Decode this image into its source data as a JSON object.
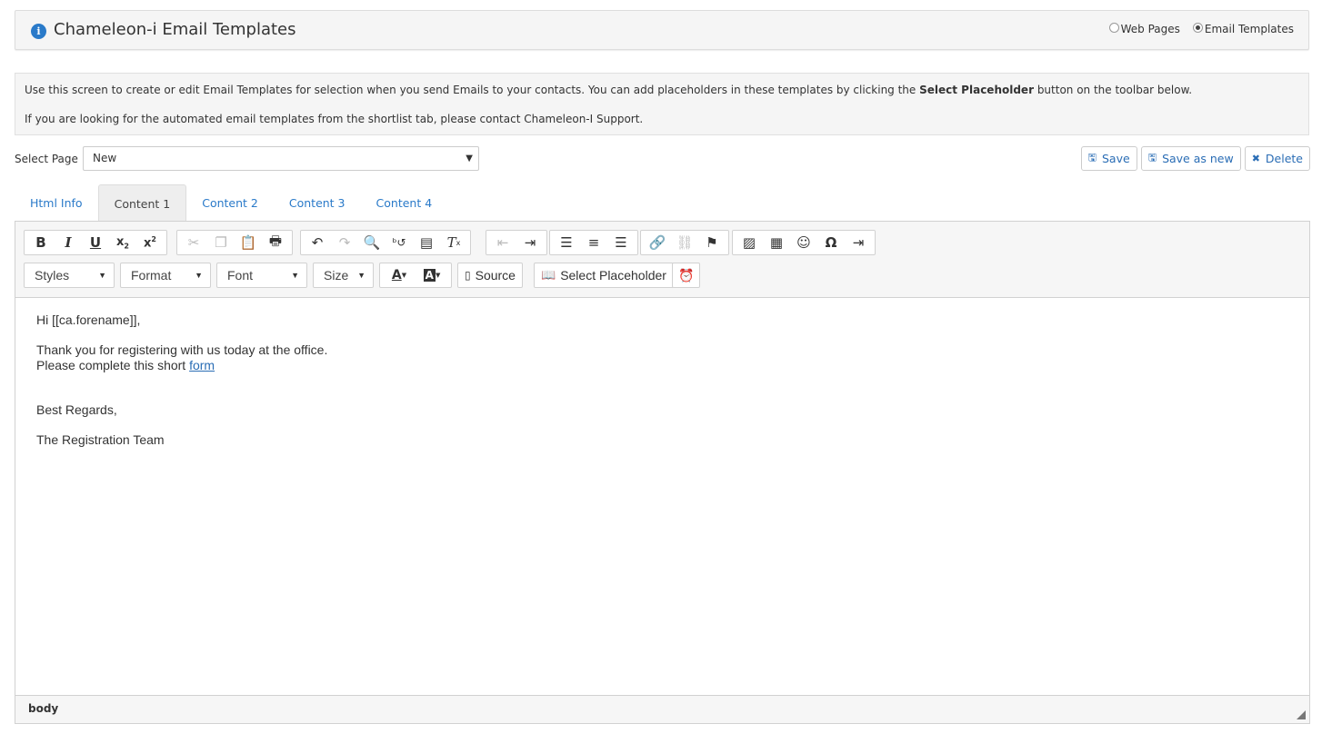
{
  "header": {
    "title": "Chameleon-i Email Templates",
    "info_icon": "info-circle-icon",
    "radio_web_pages": "Web Pages",
    "radio_email_templates": "Email Templates",
    "selected": "Email Templates"
  },
  "notice": {
    "line1_pre": "Use this screen to create or edit Email Templates for selection when you send Emails to your contacts. You can add placeholders in these templates by clicking the ",
    "line1_bold": "Select Placeholder",
    "line1_post": " button on the toolbar below.",
    "line2": "If you are looking for the automated email templates from the shortlist tab, please contact Chameleon-I Support."
  },
  "page_select": {
    "label": "Select Page",
    "value": "New"
  },
  "actions": {
    "save": "Save",
    "save_as_new": "Save as new",
    "delete": "Delete"
  },
  "tabs": [
    {
      "label": "Html Info",
      "active": false
    },
    {
      "label": "Content 1",
      "active": true
    },
    {
      "label": "Content 2",
      "active": false
    },
    {
      "label": "Content 3",
      "active": false
    },
    {
      "label": "Content 4",
      "active": false
    }
  ],
  "toolbar": {
    "styles": "Styles",
    "format": "Format",
    "font": "Font",
    "size": "Size",
    "source": "Source",
    "select_placeholder": "Select Placeholder"
  },
  "content": {
    "greeting": "Hi [[ca.forename]],",
    "line1": "Thank you for registering with us today at the office.",
    "line2_pre": "Please complete this short ",
    "line2_link": "form",
    "regards": "Best Regards,",
    "signature": "The Registration Team"
  },
  "statusbar": {
    "path": "body"
  }
}
